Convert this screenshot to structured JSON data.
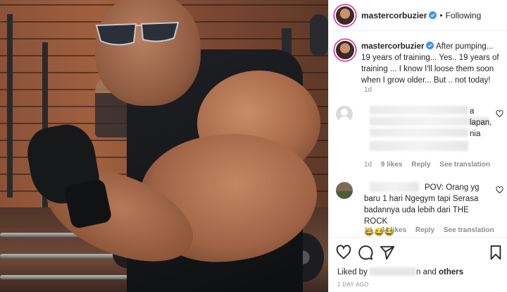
{
  "post": {
    "image_alt": "muscular man flexing arm in gym"
  },
  "header": {
    "username": "mastercorbuzier",
    "dot": "•",
    "follow_status": "Following"
  },
  "caption": {
    "username": "mastercorbuzier",
    "text": "After pumping... 19 years of training... Yes.. 19 years of training ... I know I'll loose them soon when I grow older... But .. not today!",
    "age": "1d"
  },
  "comments": [
    {
      "visible_text_fragments": [
        "a",
        "lapan,",
        "nia"
      ],
      "age": "1d",
      "likes": "9 likes",
      "reply": "Reply",
      "translate": "See translation"
    },
    {
      "text": "POV: Orang yg baru 1 hari Ngegym tapi Serasa badannya uda lebih dari THE ROCK",
      "emoji": "😂😂😂",
      "age": "1d",
      "likes": "34 likes",
      "reply": "Reply",
      "translate": "See translation"
    }
  ],
  "footer": {
    "liked_prefix": "Liked by",
    "liked_suffix": "n and",
    "others": "others",
    "date": "1 DAY AGO"
  },
  "icons": {
    "verified": "verified-badge-icon",
    "like": "heart-icon",
    "comment": "comment-icon",
    "share": "share-icon",
    "save": "bookmark-icon"
  },
  "colors": {
    "verified_blue": "#3897f0",
    "text": "#262626",
    "meta": "#8e8e8e"
  }
}
